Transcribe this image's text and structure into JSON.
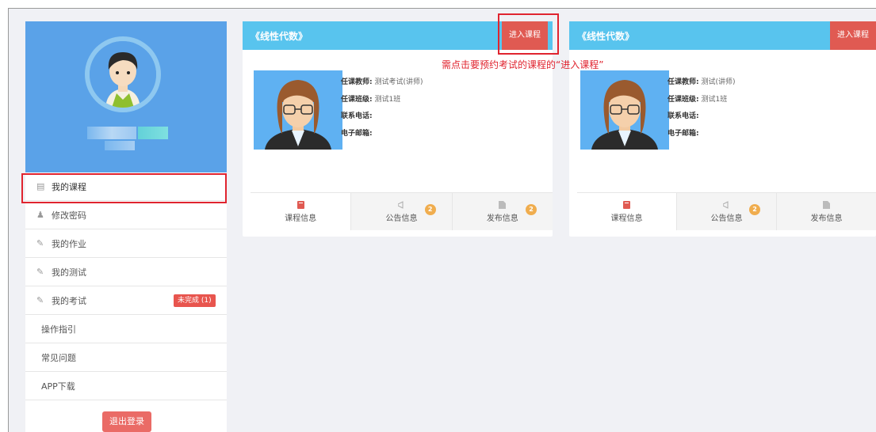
{
  "sidebar": {
    "menu": [
      {
        "label": "我的课程",
        "icon": "book-icon"
      },
      {
        "label": "修改密码",
        "icon": "user-icon"
      },
      {
        "label": "我的作业",
        "icon": "edit-icon"
      },
      {
        "label": "我的测试",
        "icon": "edit-icon"
      },
      {
        "label": "我的考试",
        "icon": "edit-icon",
        "badge": "未完成 (1)"
      },
      {
        "label": "操作指引"
      },
      {
        "label": "常见问题"
      },
      {
        "label": "APP下载"
      }
    ],
    "logout": "退出登录"
  },
  "cards": [
    {
      "title": "《线性代数》",
      "enter_label": "进入课程",
      "teacher_label": "任课教师:",
      "teacher": "测试考试(讲师)",
      "class_label": "任课班级:",
      "class": "测试1班",
      "phone_label": "联系电话:",
      "email_label": "电子邮箱:",
      "tabs": [
        {
          "label": "课程信息"
        },
        {
          "label": "公告信息",
          "count": "2"
        },
        {
          "label": "发布信息",
          "count": "2"
        }
      ]
    },
    {
      "title": "《线性代数》",
      "enter_label": "进入课程",
      "teacher_label": "任课教师:",
      "teacher": "测试(讲师)",
      "class_label": "任课班级:",
      "class": "测试1班",
      "phone_label": "联系电话:",
      "email_label": "电子邮箱:",
      "tabs": [
        {
          "label": "课程信息"
        },
        {
          "label": "公告信息",
          "count": "2"
        },
        {
          "label": "发布信息"
        }
      ]
    }
  ],
  "annotation": "需点击要预约考试的课程的“进入课程”",
  "colors": {
    "header": "#58c4ee",
    "sidebar_profile": "#5aa2e8",
    "enter_button": "#e05a52",
    "highlight": "#e0242f"
  }
}
